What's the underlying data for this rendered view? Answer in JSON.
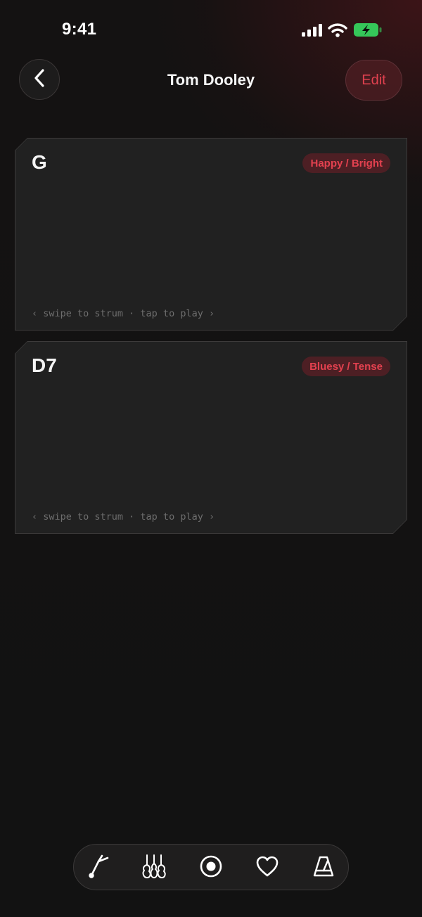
{
  "status_bar": {
    "time": "9:41",
    "battery_color": "#35c759"
  },
  "nav": {
    "title": "Tom Dooley",
    "edit_label": "Edit",
    "back_icon": "chevron-left-icon"
  },
  "chords": [
    {
      "name": "G",
      "mood": "Happy / Bright",
      "hint": "‹ swipe to strum · tap to play ›"
    },
    {
      "name": "D7",
      "mood": "Bluesy / Tense",
      "hint": "‹ swipe to strum · tap to play ›"
    }
  ],
  "tab_bar": {
    "items": [
      {
        "icon": "tuning-fork-icon"
      },
      {
        "icon": "guitars-icon"
      },
      {
        "icon": "record-icon"
      },
      {
        "icon": "heart-icon"
      },
      {
        "icon": "metronome-icon"
      }
    ]
  },
  "colors": {
    "accent": "#e0414f",
    "background": "#121212",
    "card": "#212121",
    "badge_bg": "#4d1f24"
  }
}
